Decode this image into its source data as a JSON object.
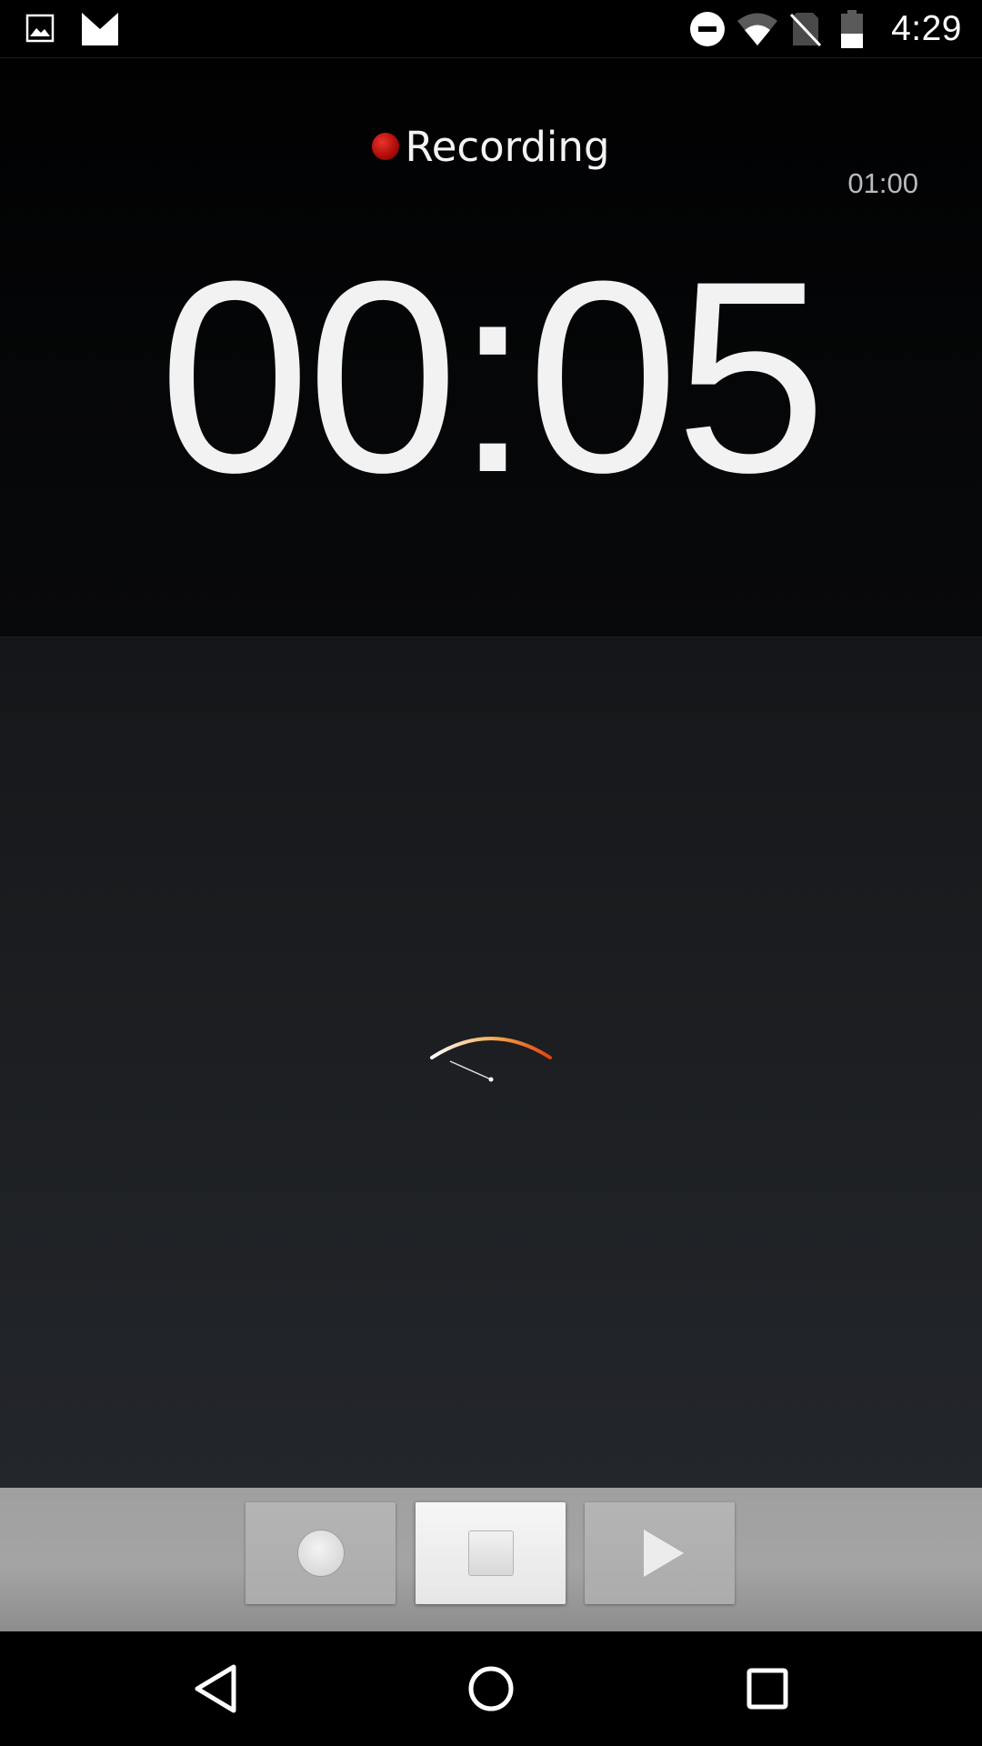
{
  "status_bar": {
    "time": "4:29",
    "left_icons": [
      "image-notification-icon",
      "gmail-notification-icon"
    ],
    "right_icons": [
      "do-not-disturb-icon",
      "wifi-icon",
      "no-sim-icon",
      "battery-icon"
    ]
  },
  "recorder": {
    "state_label": "Recording",
    "max_duration": "01:00",
    "elapsed": "00:05"
  },
  "controls": {
    "record_icon": "record-icon",
    "stop_icon": "stop-icon",
    "play_icon": "play-icon"
  },
  "nav": {
    "back_icon": "back-icon",
    "home_icon": "home-icon",
    "recents_icon": "recents-icon"
  },
  "colors": {
    "recording_dot": "#c8120d",
    "meter_gradient_start": "#ffffff",
    "meter_gradient_mid": "#f3a64a",
    "meter_gradient_end": "#e5420f"
  }
}
